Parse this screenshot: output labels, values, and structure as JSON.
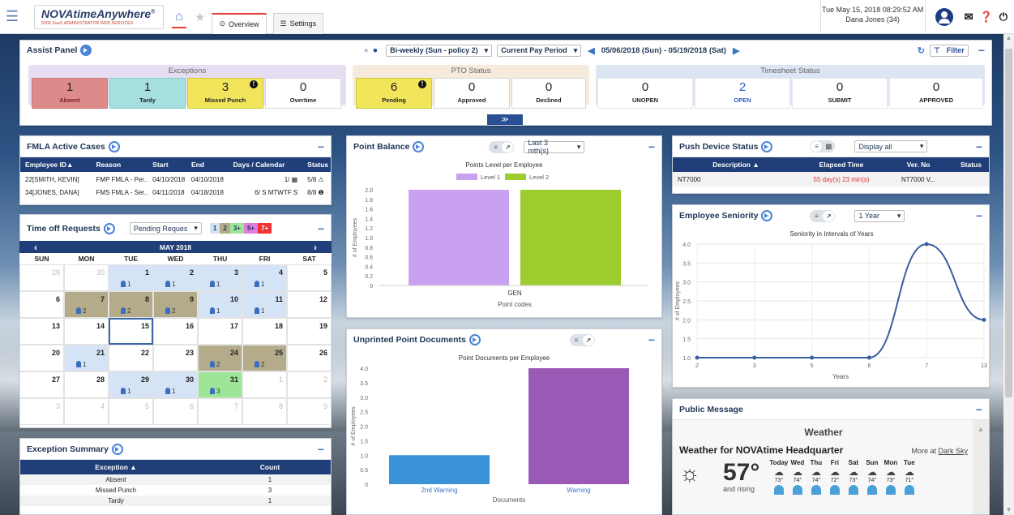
{
  "header": {
    "logo_title": "NOVAtimeAnywhere",
    "logo_reg": "®",
    "logo_sub": "5000 SaaS ADMINISTRATOR WEB SERVICES",
    "tab_overview": "Overview",
    "tab_settings": "Settings",
    "datetime": "Tue May 15, 2018 08:29:52 AM",
    "user": "Dana Jones (34)"
  },
  "assist": {
    "title": "Assist Panel",
    "policy": "Bi-weekly (Sun - policy 2)",
    "period": "Current Pay Period",
    "range": "05/06/2018 (Sun) - 05/19/2018 (Sat)",
    "filter": "Filter",
    "exceptions_title": "Exceptions",
    "pto_title": "PTO Status",
    "timesheet_title": "Timesheet Status",
    "exceptions": [
      {
        "n": "1",
        "l": "Absent"
      },
      {
        "n": "1",
        "l": "Tardy"
      },
      {
        "n": "3",
        "l": "Missed Punch"
      },
      {
        "n": "0",
        "l": "Overtime"
      }
    ],
    "pto": [
      {
        "n": "6",
        "l": "Pending"
      },
      {
        "n": "0",
        "l": "Approved"
      },
      {
        "n": "0",
        "l": "Declined"
      }
    ],
    "timesheet": [
      {
        "n": "0",
        "l": "UNOPEN"
      },
      {
        "n": "2",
        "l": "OPEN"
      },
      {
        "n": "0",
        "l": "SUBMIT"
      },
      {
        "n": "0",
        "l": "APPROVED"
      }
    ]
  },
  "fmla": {
    "title": "FMLA Active Cases",
    "cols": [
      "Employee ID▲",
      "Reason",
      "Start",
      "End",
      "Days / Calendar",
      "Status"
    ],
    "rows": [
      [
        "22[SMITH, KEVIN]",
        "FMP FMLA - Per...",
        "04/10/2018",
        "04/10/2018",
        "1/ ▦",
        "5/8 ⚠"
      ],
      [
        "34[JONES, DANA]",
        "FMS FMLA - Ser...",
        "04/11/2018",
        "04/18/2018",
        "6/ S MTWTF S",
        "8/8 ❶"
      ]
    ]
  },
  "timeoff": {
    "title": "Time off Requests",
    "filter": "Pending Reques",
    "legend": [
      "1",
      "2",
      "3+",
      "5+",
      "7+"
    ],
    "month": "MAY 2018",
    "prev": "‹",
    "next": "›",
    "days": [
      "SUN",
      "MON",
      "TUE",
      "WED",
      "THU",
      "FRI",
      "SAT"
    ],
    "cells": [
      {
        "d": "29",
        "o": true
      },
      {
        "d": "30",
        "o": true
      },
      {
        "d": "1",
        "c": "1",
        "t": "b"
      },
      {
        "d": "2",
        "c": "1",
        "t": "b"
      },
      {
        "d": "3",
        "c": "1",
        "t": "b"
      },
      {
        "d": "4",
        "c": "1",
        "t": "b"
      },
      {
        "d": "5"
      },
      {
        "d": "6"
      },
      {
        "d": "7",
        "c": "2",
        "t": "k"
      },
      {
        "d": "8",
        "c": "2",
        "t": "k"
      },
      {
        "d": "9",
        "c": "2",
        "t": "k"
      },
      {
        "d": "10",
        "c": "1",
        "t": "b"
      },
      {
        "d": "11",
        "c": "1",
        "t": "b"
      },
      {
        "d": "12"
      },
      {
        "d": "13"
      },
      {
        "d": "14"
      },
      {
        "d": "15",
        "today": true
      },
      {
        "d": "16"
      },
      {
        "d": "17"
      },
      {
        "d": "18"
      },
      {
        "d": "19"
      },
      {
        "d": "20"
      },
      {
        "d": "21",
        "c": "1",
        "t": "b"
      },
      {
        "d": "22"
      },
      {
        "d": "23"
      },
      {
        "d": "24",
        "c": "2",
        "t": "k"
      },
      {
        "d": "25",
        "c": "2",
        "t": "k"
      },
      {
        "d": "26"
      },
      {
        "d": "27"
      },
      {
        "d": "28"
      },
      {
        "d": "29",
        "c": "1",
        "t": "b"
      },
      {
        "d": "30",
        "c": "1",
        "t": "b"
      },
      {
        "d": "31",
        "c": "3",
        "t": "g"
      },
      {
        "d": "1",
        "o": true
      },
      {
        "d": "2",
        "o": true
      },
      {
        "d": "3",
        "o": true
      },
      {
        "d": "4",
        "o": true
      },
      {
        "d": "5",
        "o": true
      },
      {
        "d": "6",
        "o": true
      },
      {
        "d": "7",
        "o": true
      },
      {
        "d": "8",
        "o": true
      },
      {
        "d": "9",
        "o": true
      }
    ]
  },
  "exsum": {
    "title": "Exception Summary",
    "cols": [
      "Exception ▲",
      "Count"
    ],
    "rows": [
      [
        "Absent",
        "1"
      ],
      [
        "Missed Punch",
        "3"
      ],
      [
        "Tardy",
        "1"
      ]
    ]
  },
  "pointbal": {
    "title": "Point Balance",
    "range": "Last 3 mth(s)"
  },
  "unprinted": {
    "title": "Unprinted Point Documents"
  },
  "push": {
    "title": "Push Device Status",
    "filter": "Display all",
    "cols": [
      "Description ▲",
      "Elapsed Time",
      "Ver. No",
      "Status"
    ],
    "rows": [
      [
        "NT7000",
        "55 day(s) 23 min(s)",
        "NT7000 V...",
        ""
      ]
    ]
  },
  "seniority": {
    "title": "Employee Seniority",
    "range": "1 Year"
  },
  "public": {
    "title": "Public Message",
    "weather_title": "Weather",
    "weather_for": "Weather for NOVAtime Headquarter",
    "more": "More at ",
    "dark_sky": "Dark Sky",
    "temp": "57°",
    "cond": "and rising",
    "forecast": [
      {
        "d": "Today",
        "t": "73°"
      },
      {
        "d": "Wed",
        "t": "74°"
      },
      {
        "d": "Thu",
        "t": "74°"
      },
      {
        "d": "Fri",
        "t": "72°"
      },
      {
        "d": "Sat",
        "t": "73°"
      },
      {
        "d": "Sun",
        "t": "74°"
      },
      {
        "d": "Mon",
        "t": "73°"
      },
      {
        "d": "Tue",
        "t": "71°"
      }
    ]
  },
  "chart_data": [
    {
      "type": "bar",
      "title": "Points Level per Employee",
      "xlabel": "Point codes",
      "ylabel": "# of Employees",
      "categories": [
        "GEN"
      ],
      "series": [
        {
          "name": "Level 1",
          "values": [
            2
          ],
          "color": "#c8a2f0"
        },
        {
          "name": "Level 2",
          "values": [
            2
          ],
          "color": "#9ccc2e"
        }
      ],
      "ylim": [
        0,
        2
      ],
      "yticks": [
        "0",
        "0.2",
        "0.4",
        "0.6",
        "0.8",
        "1.0",
        "1.2",
        "1.4",
        "1.6",
        "1.8",
        "2.0"
      ],
      "grid": false,
      "legend": "top"
    },
    {
      "type": "bar",
      "title": "Point Documents per Employee",
      "xlabel": "Documents",
      "ylabel": "# of Employees",
      "categories": [
        "2nd Warning",
        "Warning"
      ],
      "values": [
        1,
        4
      ],
      "colors": [
        "#3a93d6",
        "#9b59b6"
      ],
      "ylim": [
        0,
        4
      ],
      "yticks": [
        "0",
        "0.5",
        "1.0",
        "1.5",
        "2.0",
        "2.5",
        "3.0",
        "3.5",
        "4.0"
      ]
    },
    {
      "type": "line",
      "title": "Seniority in Intervals of Years",
      "xlabel": "Years",
      "ylabel": "# of Employees",
      "x": [
        "2",
        "3",
        "5",
        "6",
        "7",
        "13"
      ],
      "y": [
        1,
        1,
        1,
        1,
        4,
        2
      ],
      "ylim": [
        1,
        4
      ],
      "yticks": [
        "1.0",
        "1.5",
        "2.0",
        "2.5",
        "3.0",
        "3.5",
        "4.0"
      ],
      "grid": true,
      "color": "#3a5fa0"
    }
  ]
}
